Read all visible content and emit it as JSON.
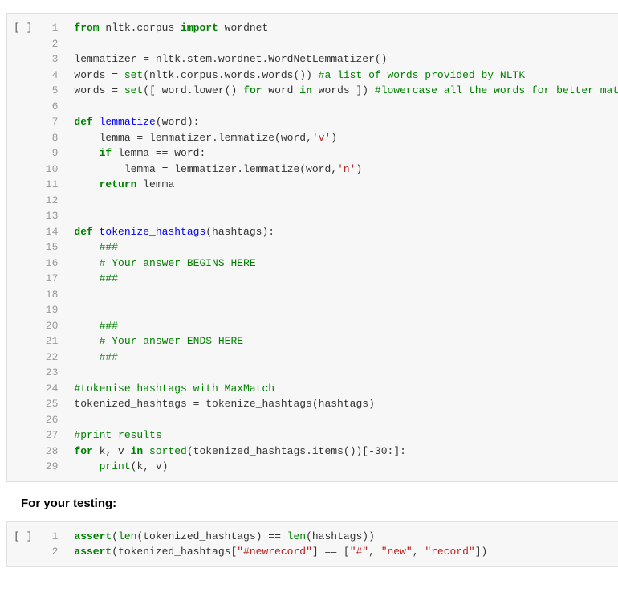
{
  "cell1": {
    "marker": "[ ]",
    "lines": [
      [
        {
          "cls": "tok-keyword",
          "t": "from"
        },
        {
          "cls": "tok-plain",
          "t": " nltk.corpus "
        },
        {
          "cls": "tok-keyword",
          "t": "import"
        },
        {
          "cls": "tok-plain",
          "t": " wordnet"
        }
      ],
      [],
      [
        {
          "cls": "tok-plain",
          "t": "lemmatizer = nltk.stem.wordnet.WordNetLemmatizer()"
        }
      ],
      [
        {
          "cls": "tok-plain",
          "t": "words = "
        },
        {
          "cls": "tok-builtin",
          "t": "set"
        },
        {
          "cls": "tok-plain",
          "t": "(nltk.corpus.words.words()) "
        },
        {
          "cls": "tok-comment",
          "t": "#a list of words provided by NLTK"
        }
      ],
      [
        {
          "cls": "tok-plain",
          "t": "words = "
        },
        {
          "cls": "tok-builtin",
          "t": "set"
        },
        {
          "cls": "tok-plain",
          "t": "([ word.lower() "
        },
        {
          "cls": "tok-keyword",
          "t": "for"
        },
        {
          "cls": "tok-plain",
          "t": " word "
        },
        {
          "cls": "tok-keyword",
          "t": "in"
        },
        {
          "cls": "tok-plain",
          "t": " words ]) "
        },
        {
          "cls": "tok-comment",
          "t": "#lowercase all the words for better mat"
        }
      ],
      [],
      [
        {
          "cls": "tok-keyword",
          "t": "def"
        },
        {
          "cls": "tok-plain",
          "t": " "
        },
        {
          "cls": "tok-func",
          "t": "lemmatize"
        },
        {
          "cls": "tok-plain",
          "t": "(word):"
        }
      ],
      [
        {
          "cls": "tok-plain",
          "t": "    lemma = lemmatizer.lemmatize(word,"
        },
        {
          "cls": "tok-string",
          "t": "'v'"
        },
        {
          "cls": "tok-plain",
          "t": ")"
        }
      ],
      [
        {
          "cls": "tok-plain",
          "t": "    "
        },
        {
          "cls": "tok-keyword",
          "t": "if"
        },
        {
          "cls": "tok-plain",
          "t": " lemma == word:"
        }
      ],
      [
        {
          "cls": "tok-plain",
          "t": "        lemma = lemmatizer.lemmatize(word,"
        },
        {
          "cls": "tok-string",
          "t": "'n'"
        },
        {
          "cls": "tok-plain",
          "t": ")"
        }
      ],
      [
        {
          "cls": "tok-plain",
          "t": "    "
        },
        {
          "cls": "tok-keyword",
          "t": "return"
        },
        {
          "cls": "tok-plain",
          "t": " lemma"
        }
      ],
      [],
      [],
      [
        {
          "cls": "tok-keyword",
          "t": "def"
        },
        {
          "cls": "tok-plain",
          "t": " "
        },
        {
          "cls": "tok-func",
          "t": "tokenize_hashtags"
        },
        {
          "cls": "tok-plain",
          "t": "(hashtags):"
        }
      ],
      [
        {
          "cls": "tok-plain",
          "t": "    "
        },
        {
          "cls": "tok-comment",
          "t": "###"
        }
      ],
      [
        {
          "cls": "tok-plain",
          "t": "    "
        },
        {
          "cls": "tok-comment",
          "t": "# Your answer BEGINS HERE"
        }
      ],
      [
        {
          "cls": "tok-plain",
          "t": "    "
        },
        {
          "cls": "tok-comment",
          "t": "###"
        }
      ],
      [],
      [],
      [
        {
          "cls": "tok-plain",
          "t": "    "
        },
        {
          "cls": "tok-comment",
          "t": "###"
        }
      ],
      [
        {
          "cls": "tok-plain",
          "t": "    "
        },
        {
          "cls": "tok-comment",
          "t": "# Your answer ENDS HERE"
        }
      ],
      [
        {
          "cls": "tok-plain",
          "t": "    "
        },
        {
          "cls": "tok-comment",
          "t": "###"
        }
      ],
      [],
      [
        {
          "cls": "tok-comment",
          "t": "#tokenise hashtags with MaxMatch"
        }
      ],
      [
        {
          "cls": "tok-plain",
          "t": "tokenized_hashtags = tokenize_hashtags(hashtags)"
        }
      ],
      [],
      [
        {
          "cls": "tok-comment",
          "t": "#print results"
        }
      ],
      [
        {
          "cls": "tok-keyword",
          "t": "for"
        },
        {
          "cls": "tok-plain",
          "t": " k, v "
        },
        {
          "cls": "tok-keyword",
          "t": "in"
        },
        {
          "cls": "tok-plain",
          "t": " "
        },
        {
          "cls": "tok-builtin",
          "t": "sorted"
        },
        {
          "cls": "tok-plain",
          "t": "(tokenized_hashtags.items())[-"
        },
        {
          "cls": "tok-plain",
          "t": "30"
        },
        {
          "cls": "tok-plain",
          "t": ":]:"
        }
      ],
      [
        {
          "cls": "tok-plain",
          "t": "    "
        },
        {
          "cls": "tok-builtin",
          "t": "print"
        },
        {
          "cls": "tok-plain",
          "t": "(k, v)"
        }
      ]
    ]
  },
  "heading": "For your testing:",
  "cell2": {
    "marker": "[ ]",
    "lines": [
      [
        {
          "cls": "tok-keyword",
          "t": "assert"
        },
        {
          "cls": "tok-plain",
          "t": "("
        },
        {
          "cls": "tok-builtin",
          "t": "len"
        },
        {
          "cls": "tok-plain",
          "t": "(tokenized_hashtags) == "
        },
        {
          "cls": "tok-builtin",
          "t": "len"
        },
        {
          "cls": "tok-plain",
          "t": "(hashtags))"
        }
      ],
      [
        {
          "cls": "tok-keyword",
          "t": "assert"
        },
        {
          "cls": "tok-plain",
          "t": "(tokenized_hashtags["
        },
        {
          "cls": "tok-string",
          "t": "\"#newrecord\""
        },
        {
          "cls": "tok-plain",
          "t": "] == ["
        },
        {
          "cls": "tok-string",
          "t": "\"#\""
        },
        {
          "cls": "tok-plain",
          "t": ", "
        },
        {
          "cls": "tok-string",
          "t": "\"new\""
        },
        {
          "cls": "tok-plain",
          "t": ", "
        },
        {
          "cls": "tok-string",
          "t": "\"record\""
        },
        {
          "cls": "tok-plain",
          "t": "])"
        }
      ]
    ]
  }
}
